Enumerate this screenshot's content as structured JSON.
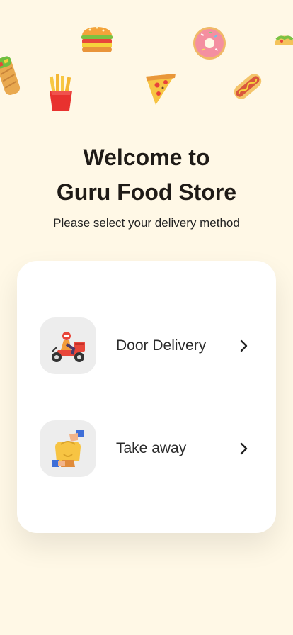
{
  "welcome": {
    "title_line1": "Welcome to",
    "title_line2": "Guru Food Store",
    "subtitle": "Please select your delivery method"
  },
  "options": [
    {
      "label": "Door Delivery",
      "icon": "scooter-delivery-icon"
    },
    {
      "label": "Take away",
      "icon": "takeaway-bag-icon"
    }
  ],
  "colors": {
    "background": "#fff8e6",
    "card": "#ffffff",
    "icon_tile": "#ededed",
    "text": "#1f1b17"
  },
  "decor_icons": [
    "burrito-icon",
    "burger-icon",
    "fries-icon",
    "pizza-slice-icon",
    "donut-icon",
    "hotdog-icon",
    "taco-icon"
  ]
}
